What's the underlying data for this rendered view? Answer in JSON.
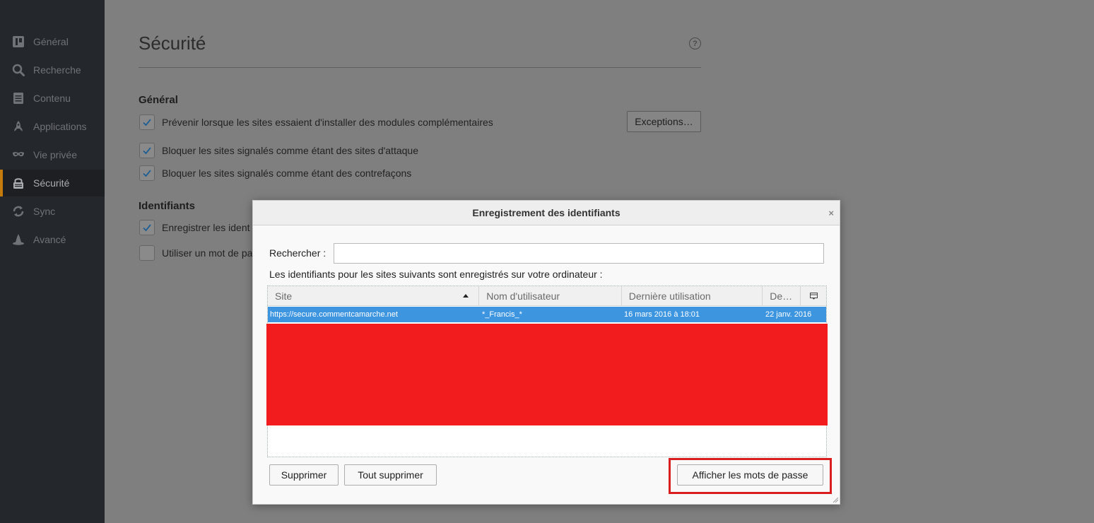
{
  "sidebar": {
    "items": [
      {
        "label": "Général",
        "icon": "general-icon"
      },
      {
        "label": "Recherche",
        "icon": "search-icon"
      },
      {
        "label": "Contenu",
        "icon": "content-icon"
      },
      {
        "label": "Applications",
        "icon": "rocket-icon"
      },
      {
        "label": "Vie privée",
        "icon": "mask-icon"
      },
      {
        "label": "Sécurité",
        "icon": "lock-icon",
        "active": true
      },
      {
        "label": "Sync",
        "icon": "sync-icon"
      },
      {
        "label": "Avancé",
        "icon": "wizard-hat-icon"
      }
    ],
    "accent_color": "#c47b0b"
  },
  "page": {
    "title": "Sécurité",
    "help_glyph": "?",
    "general_heading": "Général",
    "checkboxes": [
      {
        "label": "Prévenir lorsque les sites essaient d'installer des modules complémentaires",
        "checked": true
      },
      {
        "label": "Bloquer les sites signalés comme étant des sites d'attaque",
        "checked": true
      },
      {
        "label": "Bloquer les sites signalés comme étant des contrefaçons",
        "checked": true
      }
    ],
    "exceptions_label": "Exceptions…",
    "logins_heading": "Identifiants",
    "logins_checkboxes": [
      {
        "label": "Enregistrer les ident",
        "checked": true
      },
      {
        "label": "Utiliser un mot de pa",
        "checked": false
      }
    ]
  },
  "dialog": {
    "title": "Enregistrement des identifiants",
    "close_glyph": "×",
    "search_label": "Rechercher :",
    "search_value": "",
    "info_text": "Les identifiants pour les sites suivants sont enregistrés sur votre ordinateur :",
    "columns": [
      "Site",
      "Nom d'utilisateur",
      "Dernière utilisation",
      "De…"
    ],
    "rows": [
      {
        "site": "https://secure.commentcamarche.net",
        "username": "*_Francis_*",
        "last_used": "16 mars 2016 à 18:01",
        "date": "22 janv. 2016",
        "selected": true
      }
    ],
    "selection_color": "#3d95e0",
    "redaction_color": "#f21c1f",
    "remove_label": "Supprimer",
    "remove_all_label": "Tout supprimer",
    "show_passwords_label": "Afficher les mots de passe",
    "highlight_color": "#d81e1e"
  }
}
